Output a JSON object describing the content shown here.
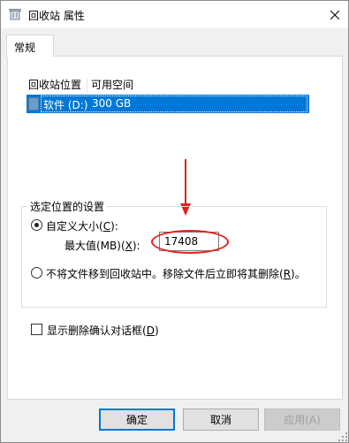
{
  "window": {
    "title": "回收站 属性",
    "close_icon": "close-icon"
  },
  "tabs": [
    {
      "label": "常规",
      "selected": true
    }
  ],
  "list": {
    "columns": [
      "回收站位置",
      "可用空间"
    ],
    "rows": [
      {
        "location": "软件 (D:)",
        "space": "300 GB",
        "selected": true
      }
    ]
  },
  "settings": {
    "legend": "选定位置的设置",
    "custom_size": {
      "label_pre": "自定义大小(",
      "accel": "C",
      "label_post": "):",
      "checked": true
    },
    "max_value": {
      "label_pre": "最大值(MB)(",
      "accel": "X",
      "label_post": "):",
      "value": "17408"
    },
    "no_recycle": {
      "label_pre": "不将文件移到回收站中。移除文件后立即将其删除(",
      "accel": "R",
      "label_post": ")。",
      "checked": false
    }
  },
  "confirm_dialog": {
    "label_pre": "显示删除确认对话框(",
    "accel": "D",
    "label_post": ")",
    "checked": false
  },
  "buttons": {
    "ok": "确定",
    "cancel": "取消",
    "apply": "应用(A)"
  },
  "colors": {
    "selection": "#0078d7",
    "annotation": "#e0211d"
  }
}
